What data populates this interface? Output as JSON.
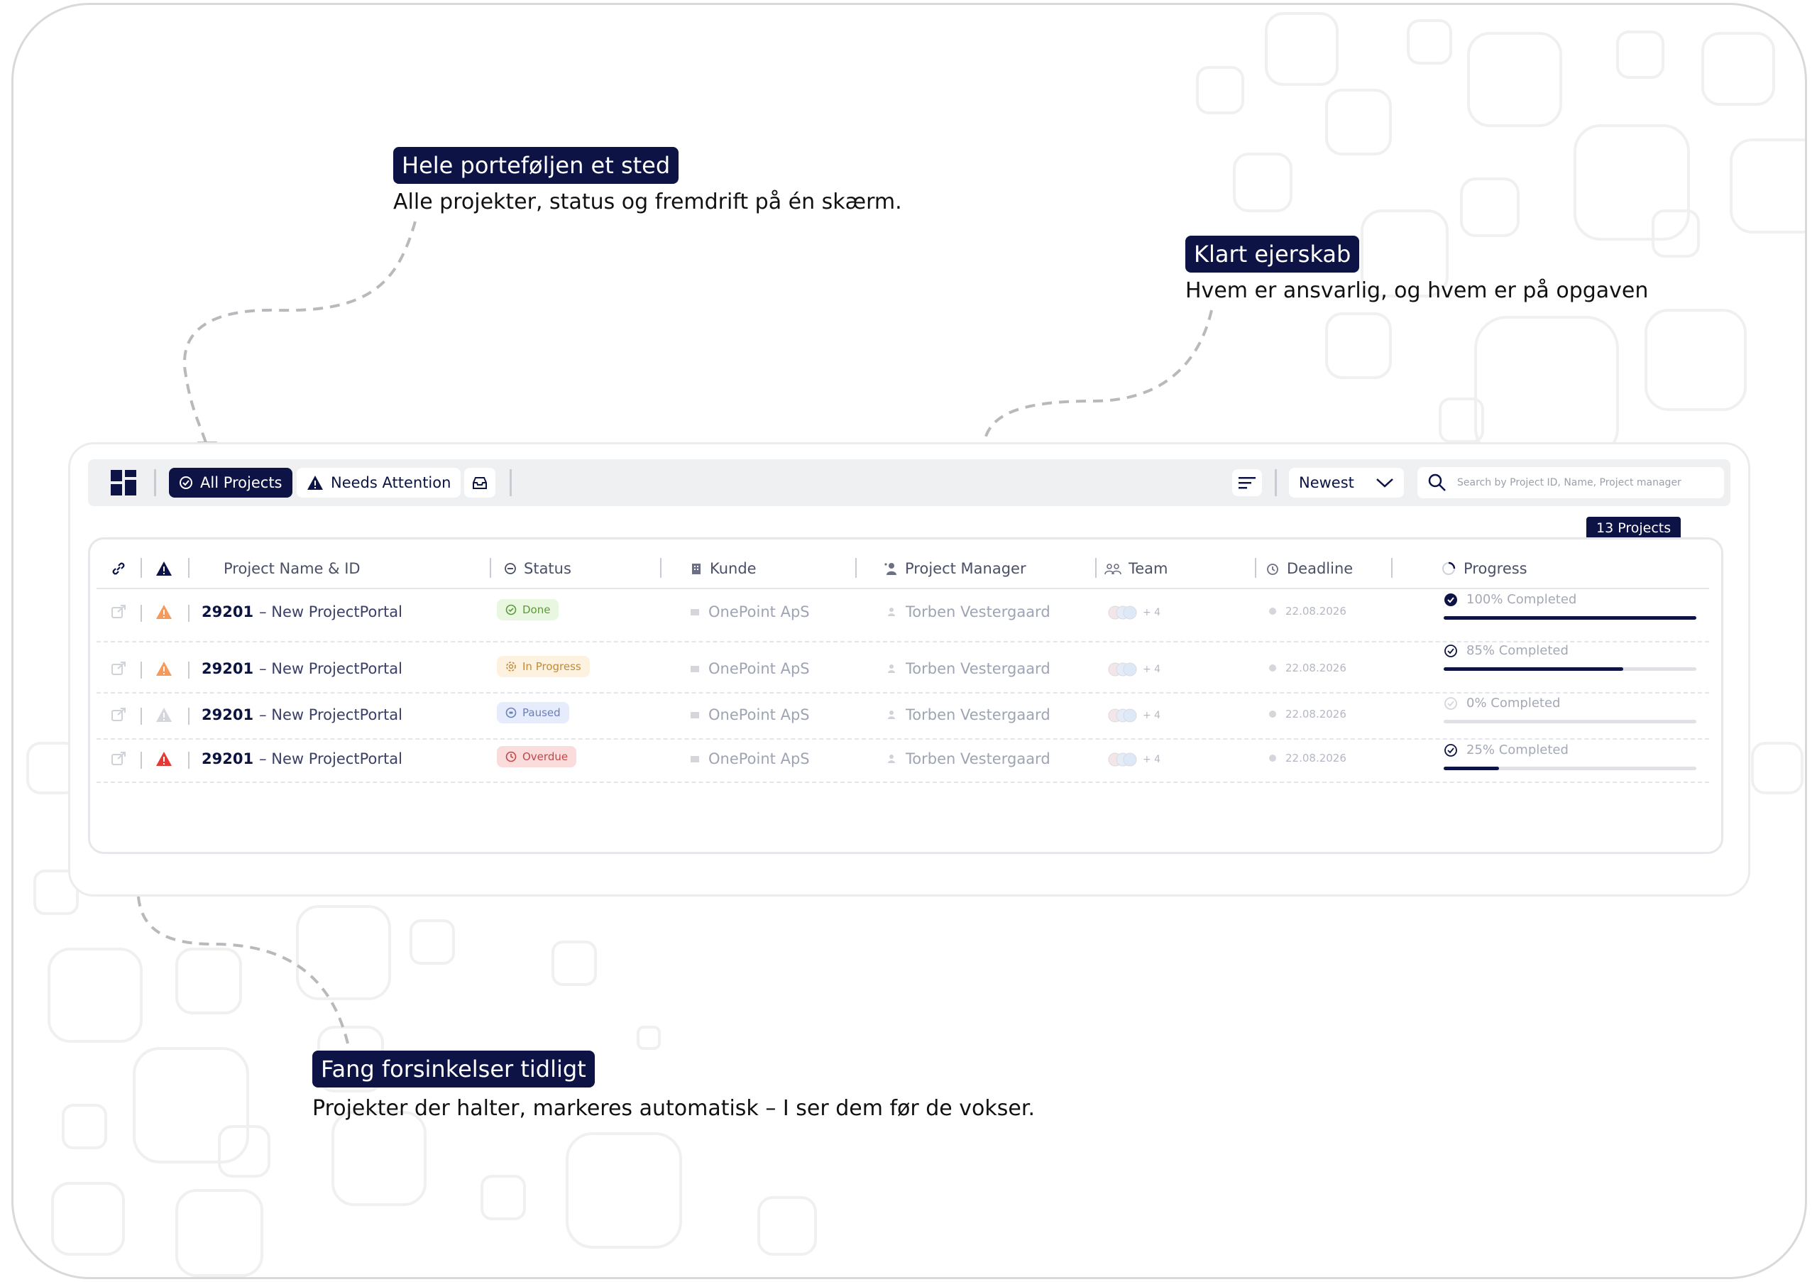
{
  "callouts": [
    {
      "title": "Hele porteføljen et sted",
      "text": "Alle projekter, status og fremdrift på én skærm."
    },
    {
      "title": "Klart ejerskab",
      "text": "Hvem er ansvarlig, og hvem er på opgaven"
    },
    {
      "title": "Fang forsinkelser tidligt",
      "text": "Projekter der halter, markeres automatisk – I ser dem før de vokser."
    }
  ],
  "toolbar": {
    "all_projects": "All Projects",
    "needs_attention": "Needs Attention",
    "sort": "Newest",
    "search_placeholder": "Search by Project ID, Name, Project manager"
  },
  "project_count": "13 Projects",
  "columns": {
    "name": "Project Name & ID",
    "status": "Status",
    "kunde": "Kunde",
    "manager": "Project Manager",
    "team": "Team",
    "deadline": "Deadline",
    "progress": "Progress"
  },
  "rows": [
    {
      "id": "29201",
      "name": "– New ProjectPortal",
      "status": "Done",
      "kunde": "OnePoint ApS",
      "manager": "Torben Vestergaard",
      "team_extra": "+ 4",
      "deadline": "22.08.2026",
      "progress_label": "100% Completed",
      "progress": 1.0,
      "alert": "orange"
    },
    {
      "id": "29201",
      "name": "– New ProjectPortal",
      "status": "In Progress",
      "kunde": "OnePoint ApS",
      "manager": "Torben Vestergaard",
      "team_extra": "+ 4",
      "deadline": "22.08.2026",
      "progress_label": "85% Completed",
      "progress": 0.71,
      "alert": "orange"
    },
    {
      "id": "29201",
      "name": "– New ProjectPortal",
      "status": "Paused",
      "kunde": "OnePoint ApS",
      "manager": "Torben Vestergaard",
      "team_extra": "+ 4",
      "deadline": "22.08.2026",
      "progress_label": "0% Completed",
      "progress": 0.0,
      "alert": "grey"
    },
    {
      "id": "29201",
      "name": "– New ProjectPortal",
      "status": "Overdue",
      "kunde": "OnePoint ApS",
      "manager": "Torben Vestergaard",
      "team_extra": "+ 4",
      "deadline": "22.08.2026",
      "progress_label": "25% Completed",
      "progress": 0.22,
      "alert": "red"
    }
  ],
  "colors": {
    "navy": "#0d1445",
    "orange": "#f59a5b",
    "red": "#e53935",
    "grey": "#d4d6dc"
  }
}
